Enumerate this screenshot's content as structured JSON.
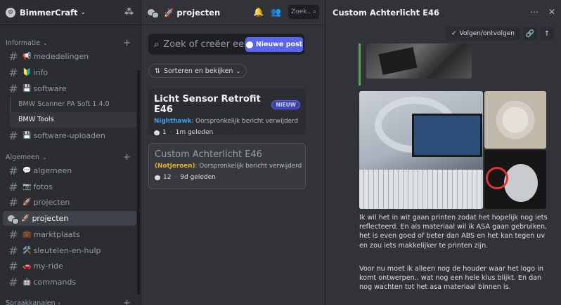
{
  "server": {
    "name": "BimmerCraft"
  },
  "sidebar": {
    "categories": [
      {
        "label": "Informatie"
      },
      {
        "label": "Algemeen"
      },
      {
        "label": "Spraakkanalen"
      }
    ],
    "channels": [
      {
        "emoji": "📢",
        "label": "mededelingen"
      },
      {
        "emoji": "🔰",
        "label": "info"
      },
      {
        "emoji": "💾",
        "label": "software"
      },
      {
        "emoji": "💾",
        "label": "software-uploaden"
      },
      {
        "emoji": "💬",
        "label": "algemeen"
      },
      {
        "emoji": "📷",
        "label": "fotos"
      },
      {
        "emoji": "🚀",
        "label": "projecten"
      },
      {
        "emoji": "🚀",
        "label": "projecten"
      },
      {
        "emoji": "💼",
        "label": "marktplaats"
      },
      {
        "emoji": "🛠️",
        "label": "sleutelen-en-hulp"
      },
      {
        "emoji": "🚗",
        "label": "my-ride"
      },
      {
        "emoji": "🤖",
        "label": "commands"
      }
    ],
    "threads": [
      {
        "label": "BMW Scanner PA Soft 1.4.0"
      },
      {
        "label": "BMW Tools"
      }
    ]
  },
  "forum": {
    "title": "🚀 projecten",
    "search_short": "Zoek..",
    "search_placeholder": "Zoek of creëer een p",
    "new_post_label": "Nieuwe post",
    "sort_label": "Sorteren en bekijken",
    "posts": [
      {
        "title": "Licht Sensor Retrofit E46",
        "badge": "NIEUW",
        "author": "Nighthawk",
        "author_color": "#3ba0f0",
        "preview": "Oorspronkelijk bericht verwijderd",
        "replies": "1",
        "time": "1m geleden"
      },
      {
        "title": "Custom Achterlicht E46",
        "author": "(NotJeroen)",
        "author_color": "#e5b318",
        "preview": "Oorspronkelijk bericht verwijderd",
        "replies": "12",
        "time": "9d geleden"
      }
    ]
  },
  "thread": {
    "title": "Custom Achterlicht E46",
    "follow_label": "Volgen/ontvolgen",
    "message_1": "Ik wil het in wit gaan printen zodat het hopelijk nog iets reflecteerd. En als materiaal wil ik ASA gaan gebruiken, het is even goed of beter dan ABS en het kan tegen uv en zou iets makkelijker te printen zijn.",
    "message_2": "Voor nu moet ik alleen nog de houder waar het logo in komt ontwerpen.. wat nog een hele klus blijkt. En dan nog wachten tot het asa materiaal binnen is."
  }
}
